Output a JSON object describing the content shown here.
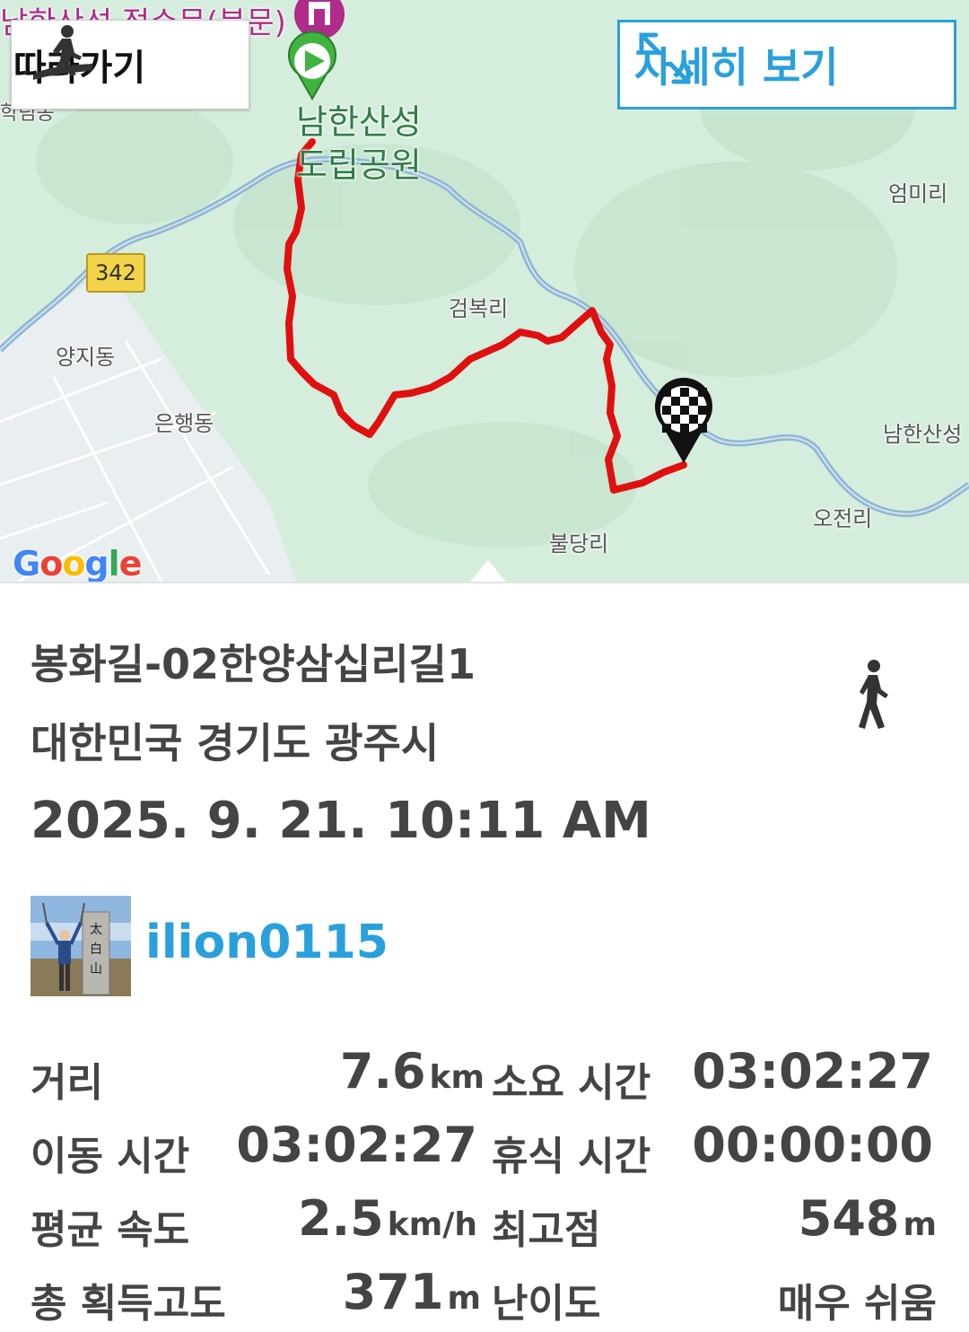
{
  "map": {
    "follow_label": "따라가기",
    "detail_label": "자세히 보기",
    "route_number": "342",
    "google_text": "Google",
    "place_labels": {
      "fortress_top": "남한산성 접수문(북문)",
      "park_line1": "남한산성",
      "park_line2": "도립공원",
      "eommi": "엄미리",
      "geombok": "검복리",
      "yangji": "양지동",
      "eunhaeng": "은행동",
      "namhansan_right": "남한산성",
      "ojeon": "오전리",
      "buldang": "불당리",
      "left_cut": "학림동"
    },
    "colors": {
      "route": "#e01010",
      "river": "#8fb6d4",
      "background": "#d5eddc",
      "accent": "#29a0dc"
    }
  },
  "trail": {
    "title": "봉화길-02한양삼십리길1",
    "location": "대한민국 경기도 광주시",
    "datetime": "2025. 9. 21. 10:11 AM",
    "activity_icon": "walking-person-icon",
    "user": {
      "name": "ilion0115",
      "avatar_text": "太白山"
    }
  },
  "stats": {
    "distance_label": "거리",
    "distance_value": "7.6",
    "distance_unit": "km",
    "duration_label": "소요 시간",
    "duration_value": "03:02:27",
    "moving_label": "이동 시간",
    "moving_value": "03:02:27",
    "rest_label": "휴식 시간",
    "rest_value": "00:00:00",
    "avg_speed_label": "평균 속도",
    "avg_speed_value": "2.5",
    "avg_speed_unit": "km/h",
    "max_alt_label": "최고점",
    "max_alt_value": "548",
    "max_alt_unit": "m",
    "gain_label": "총 획득고도",
    "gain_value": "371",
    "gain_unit": "m",
    "difficulty_label": "난이도",
    "difficulty_value": "매우 쉬움"
  }
}
